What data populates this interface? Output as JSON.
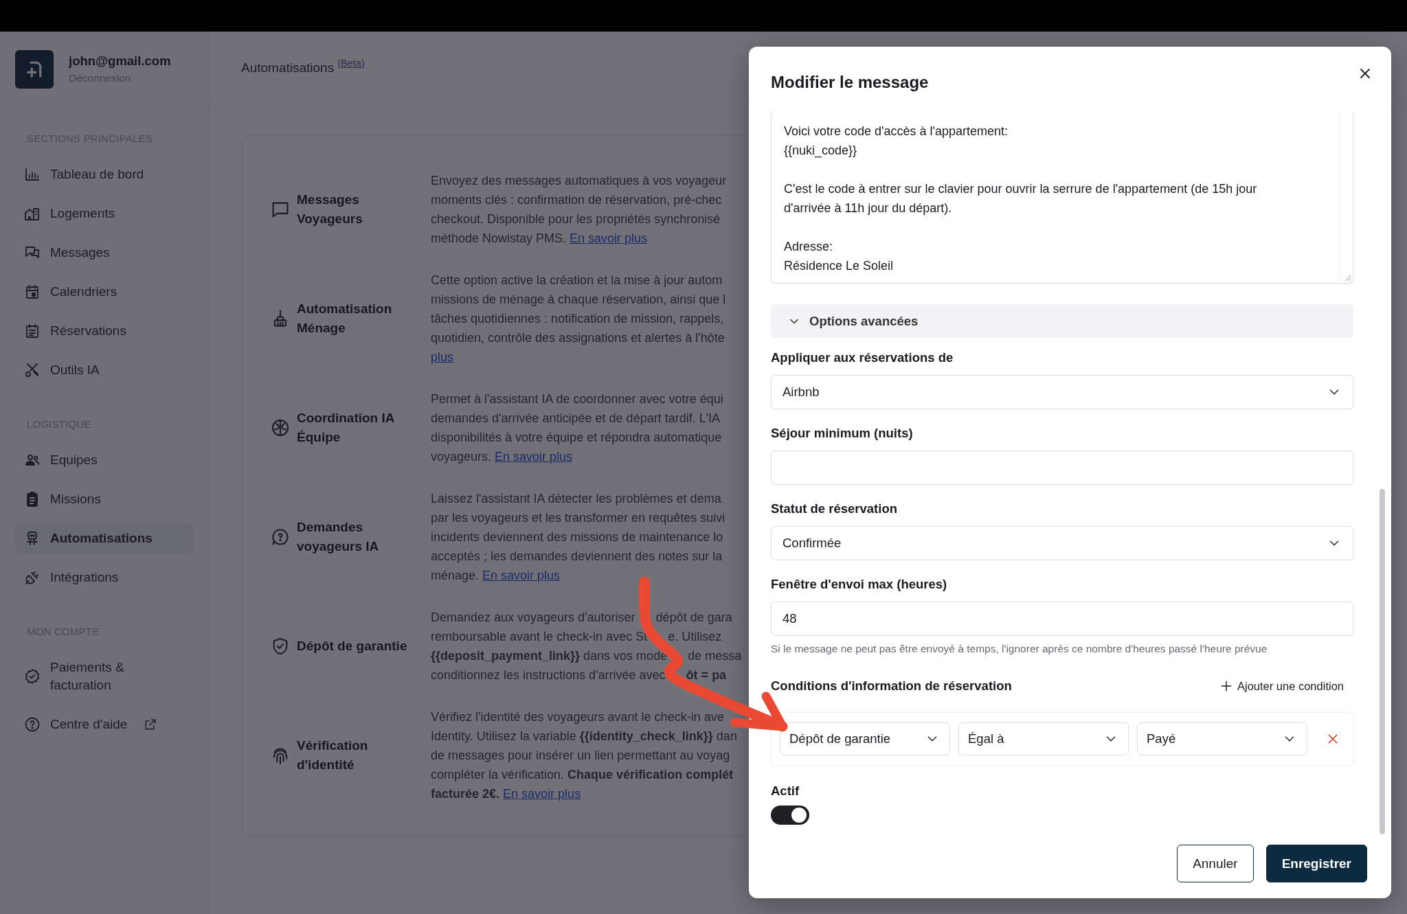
{
  "account": {
    "email": "john@gmail.com",
    "logout": "Déconnexion"
  },
  "sidebar": {
    "sections": [
      {
        "title": "SECTIONS PRINCIPALES",
        "items": [
          {
            "label": "Tableau de bord",
            "selected": false,
            "external": false
          },
          {
            "label": "Logements",
            "selected": false,
            "external": false
          },
          {
            "label": "Messages",
            "selected": false,
            "external": false
          },
          {
            "label": "Calendriers",
            "selected": false,
            "external": false
          },
          {
            "label": "Réservations",
            "selected": false,
            "external": false
          },
          {
            "label": "Outils IA",
            "selected": false,
            "external": false
          }
        ]
      },
      {
        "title": "LOGISTIQUE",
        "items": [
          {
            "label": "Equipes",
            "selected": false,
            "external": false
          },
          {
            "label": "Missions",
            "selected": false,
            "external": false
          },
          {
            "label": "Automatisations",
            "selected": true,
            "external": false
          },
          {
            "label": "Intégrations",
            "selected": false,
            "external": false
          }
        ]
      },
      {
        "title": "MON COMPTE",
        "items": [
          {
            "label": "Paiements & facturation",
            "selected": false,
            "external": false
          },
          {
            "label": "Centre d'aide",
            "selected": false,
            "external": true
          }
        ]
      }
    ]
  },
  "page": {
    "title": "Automatisations",
    "badge": "(Beta)"
  },
  "features": [
    {
      "title": "Messages Voyageurs",
      "lines": [
        {
          "text": "Envoyez des messages automatiques à vos voyageur"
        },
        {
          "text": "moments clés : confirmation de réservation, pré-chec"
        },
        {
          "text": "checkout. Disponible pour les propriétés synchronisé"
        },
        {
          "text": "méthode Nowistay PMS. ",
          "link": "En savoir plus"
        }
      ]
    },
    {
      "title": "Automatisation Ménage",
      "lines": [
        {
          "text": "Cette option active la création et la mise à jour autom"
        },
        {
          "text": "missions de ménage à chaque réservation, ainsi que l"
        },
        {
          "text": "tâches quotidiennes : notification de mission, rappels,"
        },
        {
          "text": "quotidien, contrôle des assignations et alertes à l'hôte"
        },
        {
          "link": "plus"
        }
      ]
    },
    {
      "title": "Coordination IA Équipe",
      "lines": [
        {
          "text": "Permet à l'assistant IA de coordonner avec votre équi"
        },
        {
          "text": "demandes d'arrivée anticipée et de départ tardif. L'IA"
        },
        {
          "text": "disponibilités à votre équipe et répondra automatique"
        },
        {
          "text": "voyageurs. ",
          "link": "En savoir plus"
        }
      ]
    },
    {
      "title": "Demandes voyageurs IA",
      "lines": [
        {
          "text": "Laissez l'assistant IA détecter les problèmes et dema"
        },
        {
          "text": "par les voyageurs et les transformer en requêtes suivi"
        },
        {
          "text": "incidents deviennent des missions de maintenance lo"
        },
        {
          "text": "acceptés ; les demandes deviennent des notes sur la"
        },
        {
          "text": "ménage. ",
          "link": "En savoir plus"
        }
      ]
    },
    {
      "title": "Dépôt de garantie",
      "lines": [
        {
          "text": "Demandez aux voyageurs d'autoriser",
          "after": "dépôt de gara"
        },
        {
          "text": "remboursable avant le check-in avec St",
          "after": "e. Utilisez"
        },
        {
          "text": "**{{deposit_payment_link}}** dans vos modè",
          "after": "de messa"
        },
        {
          "text": "conditionnez les instructions d'arrivée avec",
          "after": "**ôt = pa**"
        }
      ]
    },
    {
      "title": "Vérification d'identité",
      "lines": [
        {
          "text": "Vérifiez l'identité des voyageurs avant le check-in ave"
        },
        {
          "text": "Identity. Utilisez la variable **{{identity_check_link}}** dan"
        },
        {
          "text": "de messages pour insérer un lien permettant au voyag"
        },
        {
          "text": "compléter la vérification. **Chaque vérification complét**"
        },
        {
          "text": "**facturée 2€.** ",
          "link": "En savoir plus"
        }
      ]
    }
  ],
  "modal": {
    "title": "Modifier le message",
    "message": [
      {
        "lines": [
          "Voici votre code d'accès à l'appartement:",
          "{{nuki_code}}"
        ]
      },
      {
        "lines": [
          "C'est le code à entrer sur le clavier pour ouvrir la serrure de l'appartement (de 15h jour d'arrivée à 11h jour du départ)."
        ]
      },
      {
        "lines": [
          "Adresse:",
          "Résidence Le Soleil"
        ]
      }
    ],
    "advanced": {
      "label": "Options avancées",
      "expanded": true
    },
    "fields": [
      {
        "kind": "select",
        "label": "Appliquer aux réservations de",
        "value": "Airbnb"
      },
      {
        "kind": "input",
        "label": "Séjour minimum (nuits)"
      },
      {
        "kind": "select",
        "label": "Statut de réservation",
        "value": "Confirmée"
      },
      {
        "kind": "input",
        "label": "Fenêtre d'envoi max (heures)",
        "value": "48",
        "hint": "Si le message ne peut pas être envoyé à temps, l'ignorer après ce nombre d'heures passé l'heure prévue"
      }
    ],
    "conditions": {
      "title": "Conditions d'information de réservation",
      "add": "Ajouter une condition",
      "rows": [
        {
          "field": "Dépôt de garantie",
          "operator": "Égal à",
          "value": "Payé"
        }
      ]
    },
    "active": {
      "label": "Actif",
      "on": true
    },
    "buttons": [
      {
        "label": "Annuler",
        "kind": "secondary"
      },
      {
        "label": "Enregistrer",
        "kind": "primary"
      }
    ]
  }
}
